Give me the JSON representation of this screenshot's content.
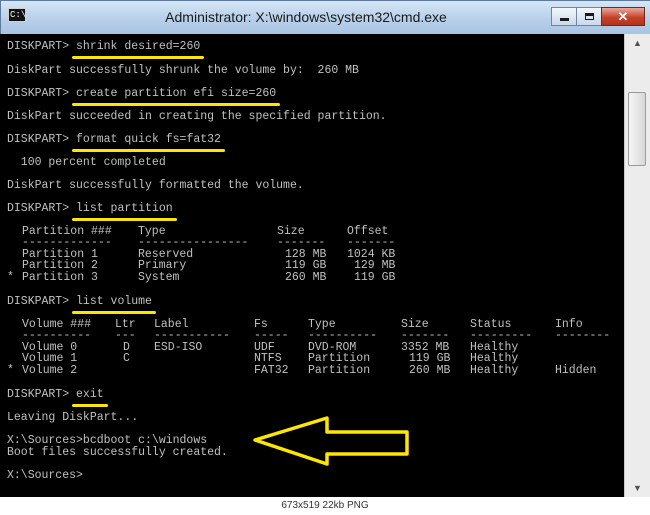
{
  "window": {
    "title": "Administrator: X:\\windows\\system32\\cmd.exe",
    "icon_text": "C:\\",
    "controls": {
      "minimize": "minimize-icon",
      "maximize": "maximize-icon",
      "close": "close-icon"
    }
  },
  "console": {
    "prompt": "DISKPART>",
    "commands": [
      "shrink desired=260",
      "create partition efi size=260",
      "format quick fs=fat32",
      "list partition",
      "list volume",
      "exit"
    ],
    "outputs": {
      "shrink": "DiskPart successfully shrunk the volume by:  260 MB",
      "create": "DiskPart succeeded in creating the specified partition.",
      "format_progress": "  100 percent completed",
      "format_done": "DiskPart successfully formatted the volume.",
      "leaving": "Leaving DiskPart...",
      "bcdboot_cmd": "X:\\Sources>bcdboot c:\\windows",
      "bcdboot_result": "Boot files successfully created.",
      "final_prompt": "X:\\Sources>"
    },
    "partition_table": {
      "headers": [
        "Partition ###",
        "Type",
        "Size",
        "Offset"
      ],
      "separators": [
        "-------------",
        "----------------",
        "-------",
        "-------"
      ],
      "rows": [
        {
          "marker": " ",
          "partition": "Partition 1",
          "type": "Reserved",
          "size": "128 MB",
          "offset": "1024 KB"
        },
        {
          "marker": " ",
          "partition": "Partition 2",
          "type": "Primary",
          "size": "119 GB",
          "offset": "129 MB"
        },
        {
          "marker": "*",
          "partition": "Partition 3",
          "type": "System",
          "size": "260 MB",
          "offset": "119 GB"
        }
      ]
    },
    "volume_table": {
      "headers": [
        "Volume ###",
        "Ltr",
        "Label",
        "Fs",
        "Type",
        "Size",
        "Status",
        "Info"
      ],
      "separators": [
        "----------",
        "---",
        "-----------",
        "-----",
        "----------",
        "-------",
        "---------",
        "--------"
      ],
      "rows": [
        {
          "marker": " ",
          "volume": "Volume 0",
          "ltr": "D",
          "label": "ESD-ISO",
          "fs": "UDF",
          "type": "DVD-ROM",
          "size": "3352 MB",
          "status": "Healthy",
          "info": ""
        },
        {
          "marker": " ",
          "volume": "Volume 1",
          "ltr": "C",
          "label": "",
          "fs": "NTFS",
          "type": "Partition",
          "size": "119 GB",
          "status": "Healthy",
          "info": ""
        },
        {
          "marker": "*",
          "volume": "Volume 2",
          "ltr": "",
          "label": "",
          "fs": "FAT32",
          "type": "Partition",
          "size": "260 MB",
          "status": "Healthy",
          "info": "Hidden"
        }
      ]
    }
  },
  "scrollbar": {
    "up": "scroll-up-icon",
    "down": "scroll-down-icon"
  },
  "annotation": {
    "highlight_color": "#ffe600",
    "arrow_color": "#ffe600"
  },
  "image_info": "673x519  22kb  PNG"
}
